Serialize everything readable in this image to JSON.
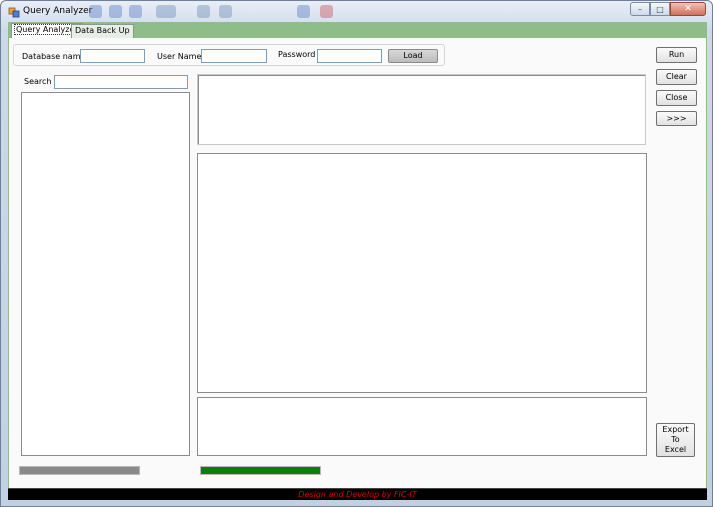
{
  "window": {
    "title": "Query Analyzer",
    "controls": {
      "minimize": "–",
      "maximize": "□",
      "close": "✕"
    }
  },
  "tabs": [
    {
      "label": "Query Analyzer",
      "active": true
    },
    {
      "label": "Data Back Up",
      "active": false
    }
  ],
  "login": {
    "database_label": "Database name",
    "database_value": "",
    "username_label": "User Name",
    "username_value": "",
    "password_label": "Password",
    "password_value": "",
    "load_button": "Load"
  },
  "search": {
    "label": "Search",
    "value": ""
  },
  "actions": {
    "run": "Run",
    "clear": "Clear",
    "close": "Close",
    "more": ">>>",
    "export_line1": "Export",
    "export_line2": "To",
    "export_line3": "Excel"
  },
  "progress": {
    "left_fraction": 1.0,
    "left_color": "#8a8a8a",
    "right_fraction": 1.0,
    "right_color": "#0a7f0a"
  },
  "status": {
    "text": "Design and Develop by FIC-IT",
    "color": "#d40000",
    "background": "#000000"
  }
}
